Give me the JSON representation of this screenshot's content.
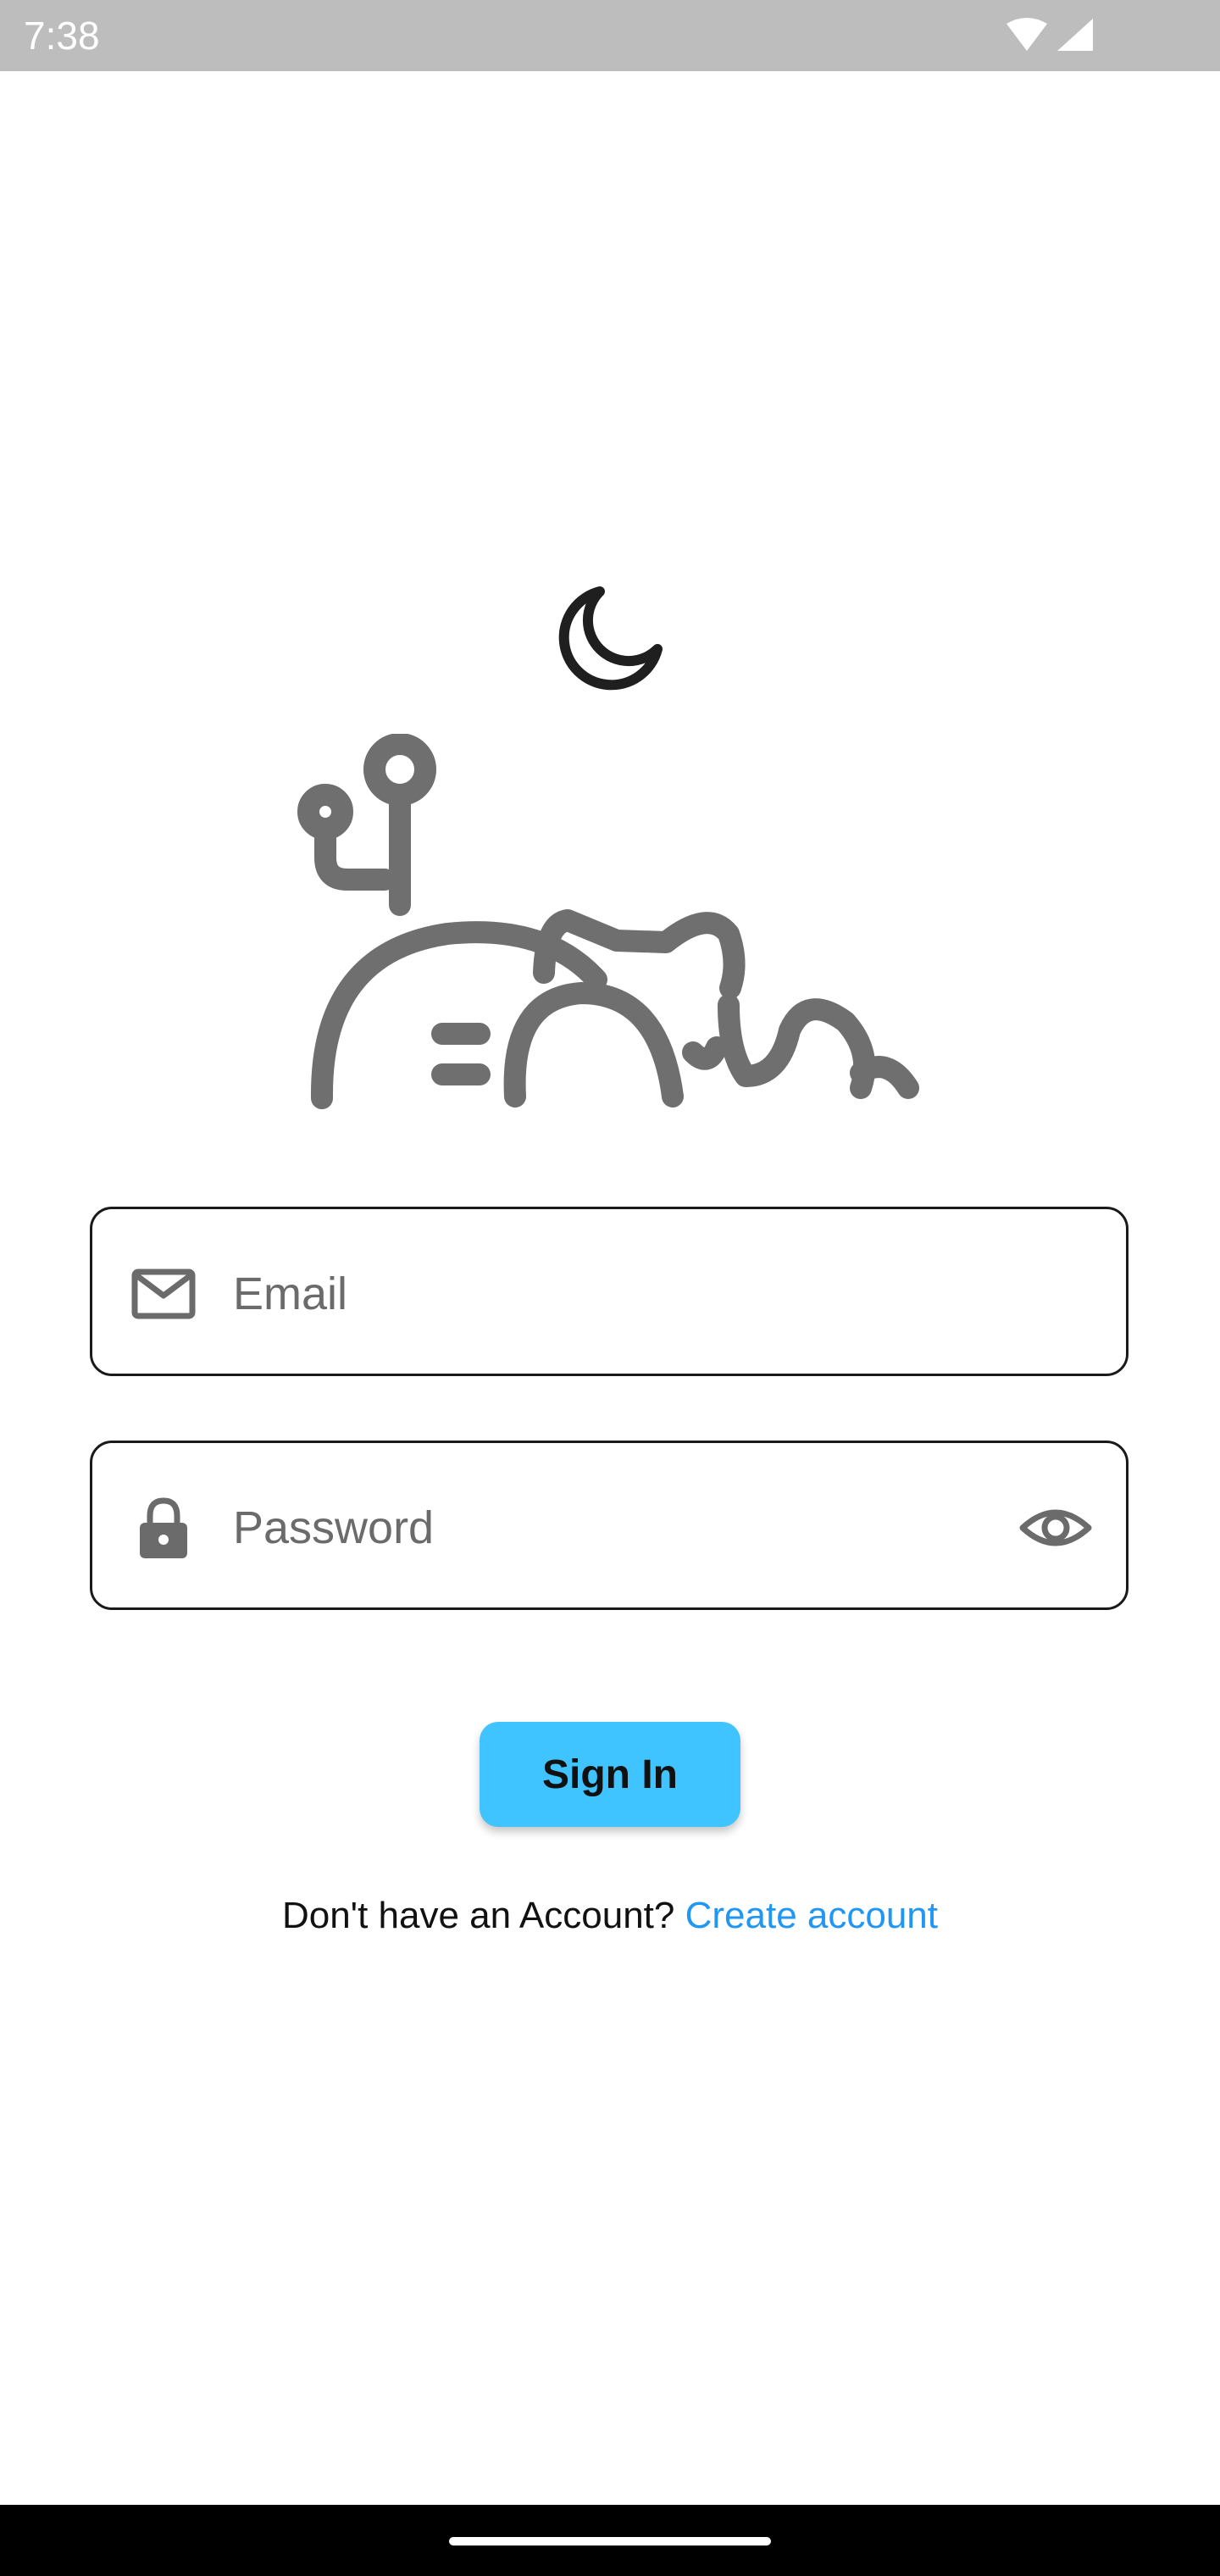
{
  "status_bar": {
    "time": "7:38",
    "icons": [
      "wifi-icon",
      "cell-signal-icon"
    ]
  },
  "logo": {
    "icons": [
      "moon-icon",
      "sleeping-cat-logo"
    ]
  },
  "form": {
    "email": {
      "placeholder": "Email",
      "value": "",
      "icon": "mail-icon"
    },
    "password": {
      "placeholder": "Password",
      "value": "",
      "icon": "lock-icon",
      "toggle_icon": "eye-icon"
    },
    "sign_in_label": "Sign In",
    "no_account_text": "Don't have an Account?",
    "create_account_label": "Create account"
  },
  "colors": {
    "accent": "#40c4ff",
    "link": "#2196f3",
    "status_bar": "#bdbdbd",
    "icon_gray": "#6b6b6b"
  }
}
